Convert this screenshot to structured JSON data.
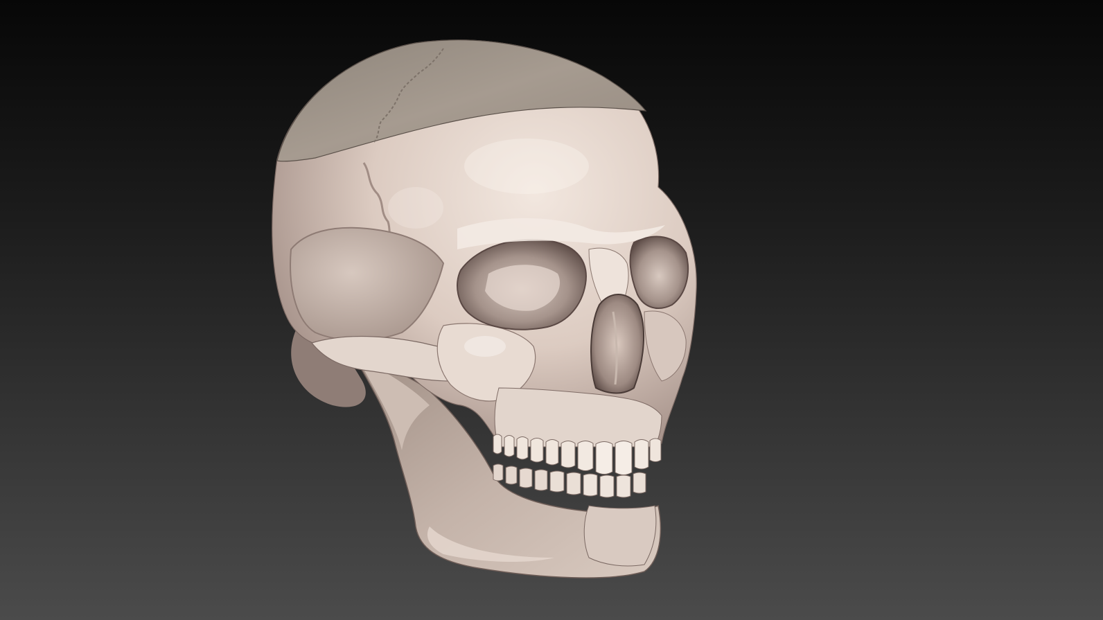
{
  "scene": {
    "subject": "skull-model",
    "colors": {
      "background_top": "#070707",
      "background_bottom": "#4b4b4b",
      "bone_light": "#ece0d8",
      "bone_mid": "#c9b9ae",
      "bone_shadow": "#8d7b74",
      "bone_deep": "#4a3d3a",
      "cap_light": "#a89e93",
      "cap_dark": "#8a7f75",
      "jaw": "#b0a096",
      "tooth": "#f0e6dd",
      "cavity": "#2e2220"
    }
  }
}
